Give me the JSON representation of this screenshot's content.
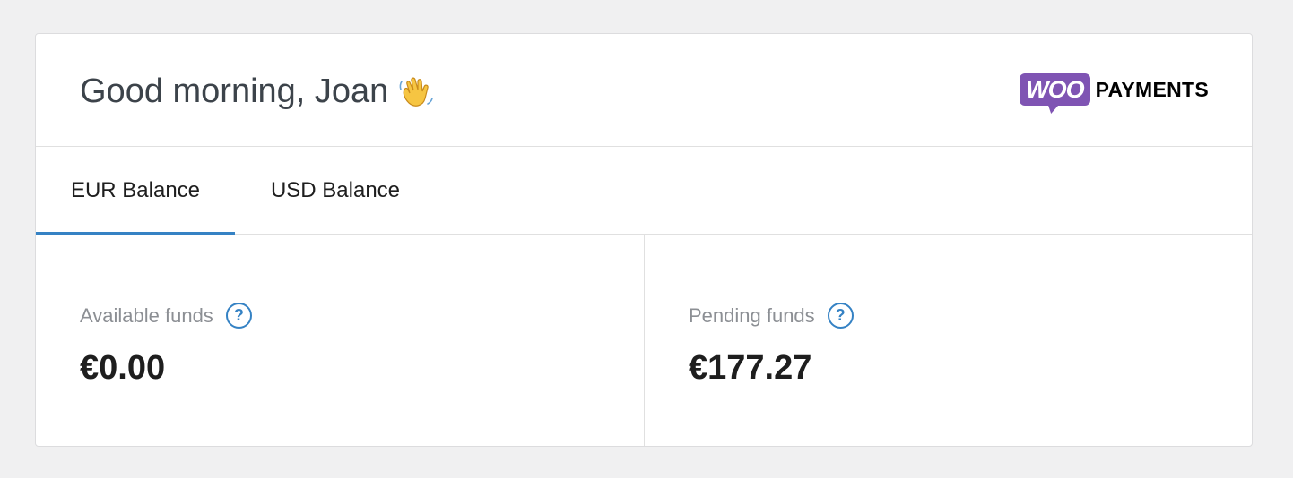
{
  "header": {
    "greeting": "Good morning, Joan",
    "greeting_emoji_icon": "waving-hand-icon",
    "logo": {
      "woo": "WOO",
      "payments": "PAYMENTS",
      "brand_color": "#7f54b3"
    }
  },
  "tabs": [
    {
      "label": "EUR Balance",
      "active": true
    },
    {
      "label": "USD Balance",
      "active": false
    }
  ],
  "funds": {
    "available": {
      "label": "Available funds",
      "amount": "€0.00",
      "help_icon": "question-mark-icon"
    },
    "pending": {
      "label": "Pending funds",
      "amount": "€177.27",
      "help_icon": "question-mark-icon"
    }
  },
  "colors": {
    "accent": "#3582c4",
    "text": "#1e1e1e",
    "muted": "#8c8f94"
  }
}
